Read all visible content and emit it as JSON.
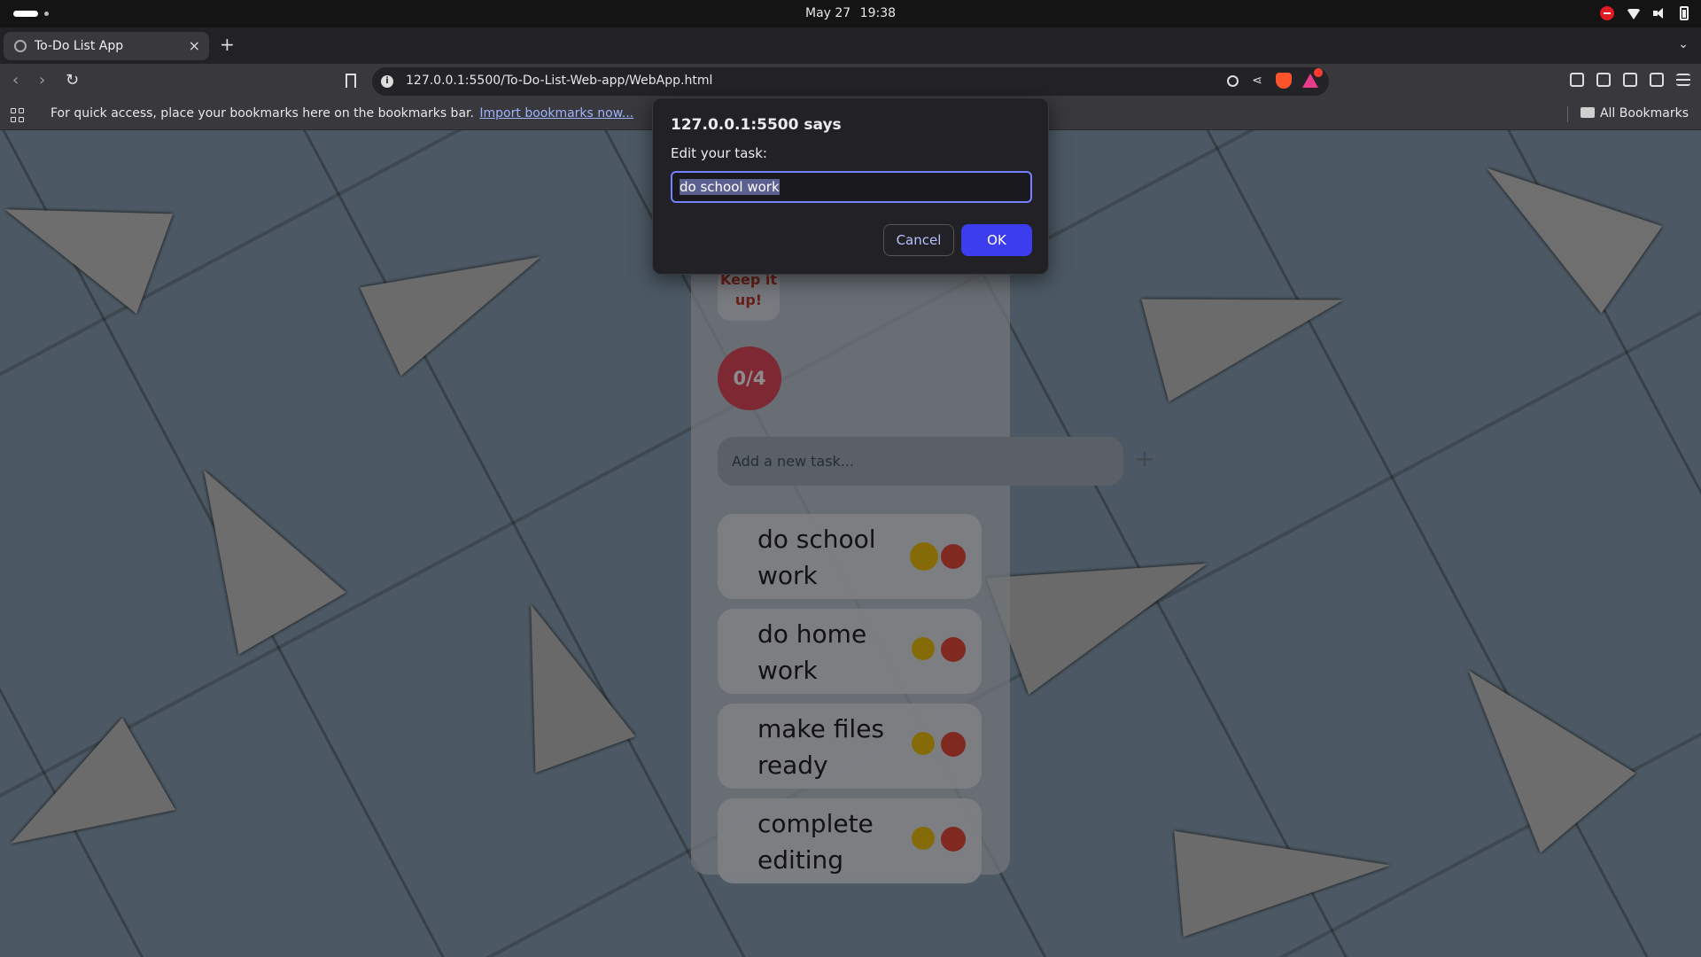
{
  "os": {
    "date": "May 27",
    "time": "19:38"
  },
  "browser": {
    "tab_title": "To-Do List App",
    "tab_close": "×",
    "new_tab": "+",
    "url": "127.0.0.1:5500/To-Do-List-Web-app/WebApp.html",
    "bookmarks_message": "For quick access, place your bookmarks here on the bookmarks bar.",
    "import_link": "Import bookmarks now...",
    "all_bookmarks": "All Bookmarks"
  },
  "app": {
    "encouragement": "Keep it up!",
    "progress": "0/4",
    "input_placeholder": "Add a new task...",
    "add_label": "+",
    "tasks": [
      {
        "text": "do school work"
      },
      {
        "text": "do home work"
      },
      {
        "text": "make files ready"
      },
      {
        "text": "complete editing"
      }
    ],
    "colors": {
      "progress": "#e64a5f",
      "edit_button": "#f1c40f",
      "delete_button": "#e74c3c"
    }
  },
  "dialog": {
    "title": "127.0.0.1:5500 says",
    "message": "Edit your task:",
    "value": "do school work",
    "cancel_label": "Cancel",
    "ok_label": "OK",
    "accent": "#3d3df0"
  }
}
